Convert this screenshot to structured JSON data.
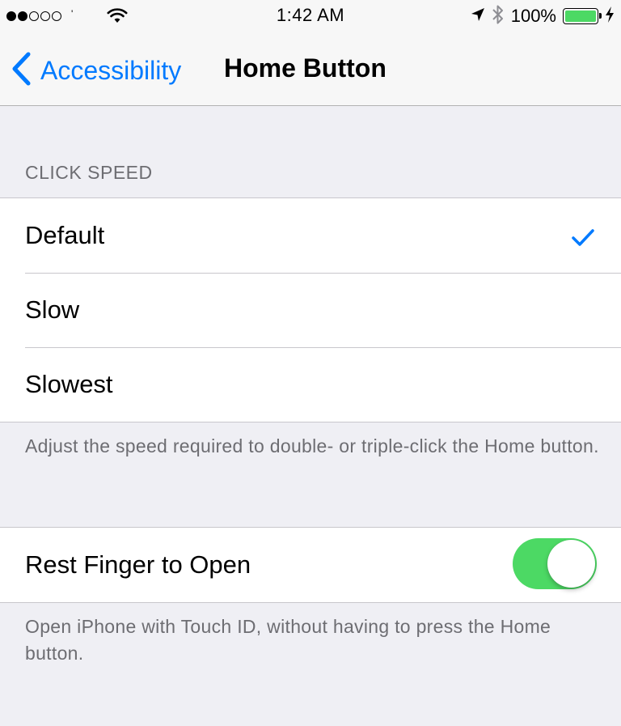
{
  "status_bar": {
    "signal_dots_filled": 2,
    "signal_dots_total": 5,
    "carrier": "'",
    "time": "1:42 AM",
    "battery_percent": "100%",
    "icons": [
      "wifi-icon",
      "location-arrow-icon",
      "bluetooth-icon",
      "battery-icon",
      "charging-bolt-icon"
    ]
  },
  "nav": {
    "back_label": "Accessibility",
    "title": "Home Button",
    "accent_color": "#007aff"
  },
  "click_speed": {
    "header": "CLICK SPEED",
    "options": [
      {
        "label": "Default",
        "selected": true
      },
      {
        "label": "Slow",
        "selected": false
      },
      {
        "label": "Slowest",
        "selected": false
      }
    ],
    "footer": "Adjust the speed required to double- or triple-click the Home button."
  },
  "rest_finger": {
    "label": "Rest Finger to Open",
    "enabled": true,
    "toggle_on_color": "#4cd964",
    "footer": "Open iPhone with Touch ID, without having to press the Home button."
  }
}
